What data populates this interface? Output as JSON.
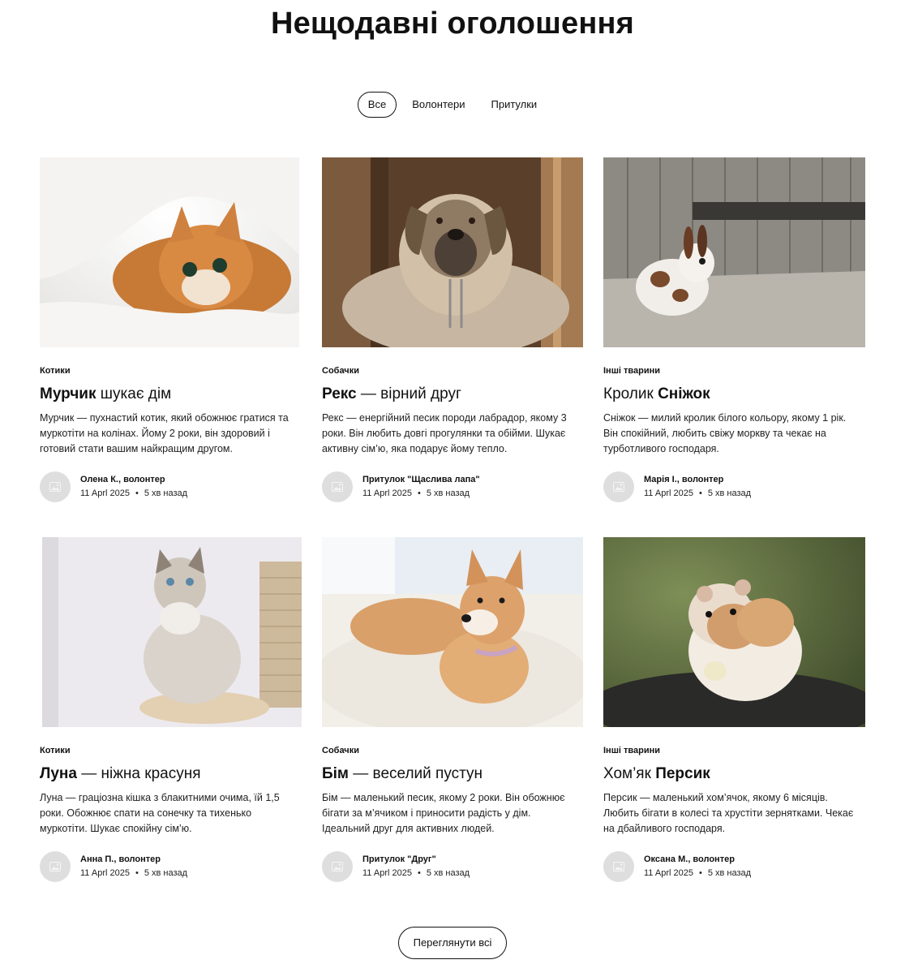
{
  "page": {
    "title": "Нещодавні оголошення"
  },
  "filters": [
    {
      "label": "Все",
      "active": true
    },
    {
      "label": "Волонтери",
      "active": false
    },
    {
      "label": "Притулки",
      "active": false
    }
  ],
  "cards": [
    {
      "category": "Котики",
      "title_bold": "Мурчик",
      "title_rest": " шукає дім",
      "description": "Мурчик — пухнастий котик, який обожнює гратися та муркотіти на колінах. Йому 2 роки, він здоровий і готовий стати вашим найкращим другом.",
      "author": "Олена К., волонтер",
      "date": "11 Aprl 2025",
      "ago": "5 хв назад",
      "image": "orange-cat-photo"
    },
    {
      "category": "Собачки",
      "title_bold": "Рекс",
      "title_rest": " — вірний друг",
      "description": "Рекс — енергійний песик породи лабрадор, якому 3 роки. Він любить довгі прогулянки та обійми. Шукає активну сім’ю, яка подарує йому тепло.",
      "author": "Притулок \"Щаслива лапа\"",
      "date": "11 Aprl 2025",
      "ago": "5 хв назад",
      "image": "dog-in-kennel-photo"
    },
    {
      "category": "Інші тварини",
      "title_pre": "Кролик ",
      "title_bold": "Сніжок",
      "description": "Сніжок — милий кролик білого кольору, якому 1 рік. Він спокійний, любить свіжу моркву та чекає на турботливого господаря.",
      "author": "Марія І., волонтер",
      "date": "11 Aprl 2025",
      "ago": "5 хв назад",
      "image": "rabbit-photo"
    },
    {
      "category": "Котики",
      "title_bold": "Луна",
      "title_rest": " — ніжна красуня",
      "description": "Луна — граціозна кішка з блакитними очима, їй 1,5 роки. Обожнює спати на сонечку та тихенько муркотіти. Шукає спокійну сім’ю.",
      "author": "Анна П., волонтер",
      "date": "11 Aprl 2025",
      "ago": "5 хв назад",
      "image": "fluffy-cat-photo"
    },
    {
      "category": "Собачки",
      "title_bold": "Бім",
      "title_rest": " — веселий пустун",
      "description": "Бім — маленький песик, якому 2 роки. Він обожнює бігати за м’ячиком і приносити радість у дім. Ідеальний друг для активних людей.",
      "author": "Притулок \"Друг\"",
      "date": "11 Aprl 2025",
      "ago": "5 хв назад",
      "image": "puppy-photo"
    },
    {
      "category": "Інші тварини",
      "title_pre": "Хом’як ",
      "title_bold": "Персик",
      "description": "Персик — маленький хом’ячок, якому 6 місяців. Любить бігати в колесі та хрустіти зернятками. Чекає на дбайливого господаря.",
      "author": "Оксана М., волонтер",
      "date": "11 Aprl 2025",
      "ago": "5 хв назад",
      "image": "hamster-photo"
    }
  ],
  "footer": {
    "view_all_label": "Переглянути всі"
  },
  "icons": {
    "avatar": "image-placeholder-icon"
  }
}
